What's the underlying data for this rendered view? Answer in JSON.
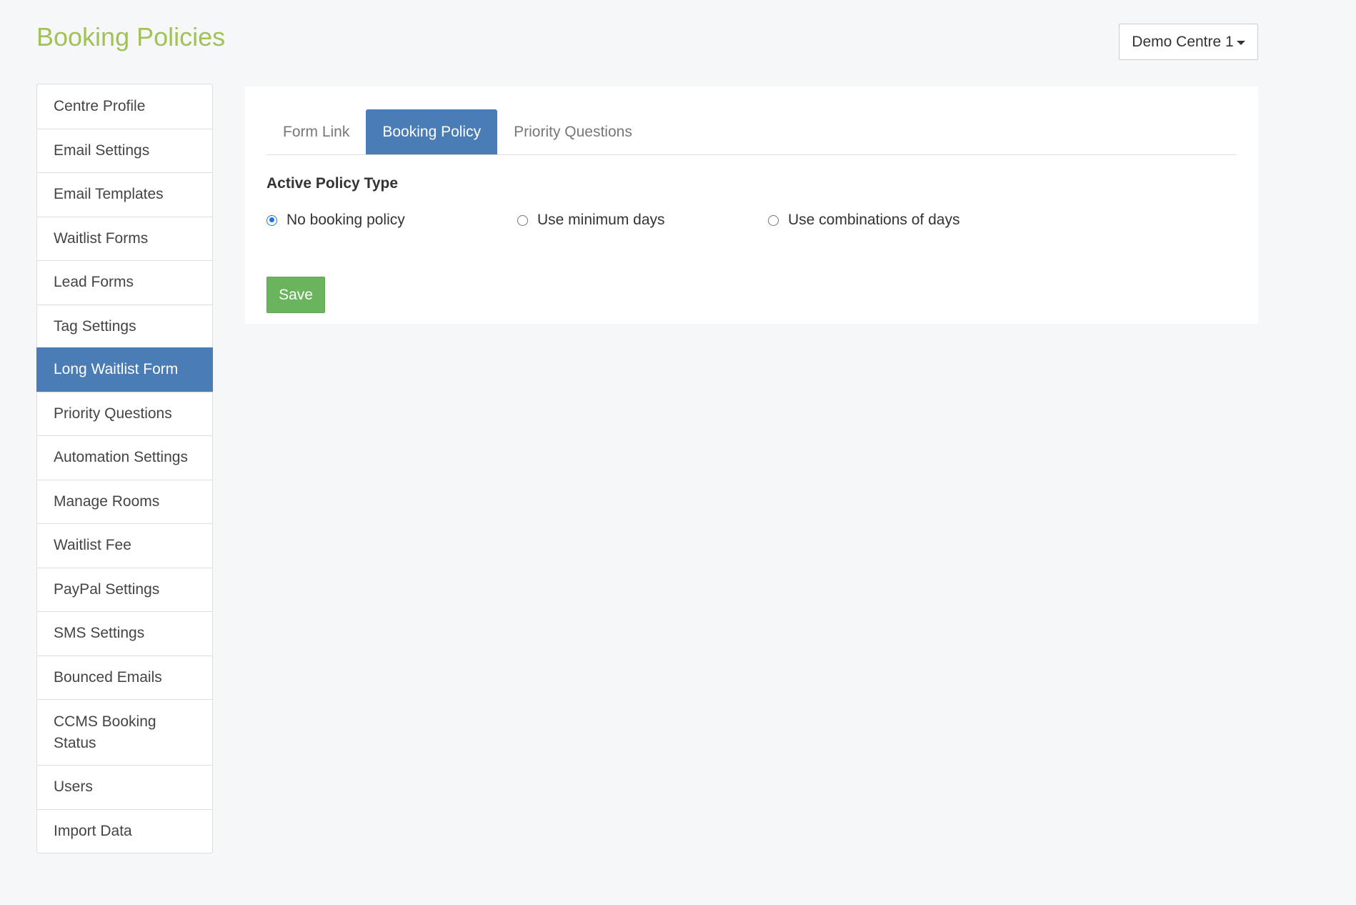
{
  "header": {
    "title": "Booking Policies",
    "centre_selector": "Demo Centre 1"
  },
  "sidebar": {
    "items": [
      {
        "label": "Centre Profile"
      },
      {
        "label": "Email Settings"
      },
      {
        "label": "Email Templates"
      },
      {
        "label": "Waitlist Forms"
      },
      {
        "label": "Lead Forms"
      },
      {
        "label": "Tag Settings"
      },
      {
        "label": "Long Waitlist Form",
        "active": true
      },
      {
        "label": "Priority Questions"
      },
      {
        "label": "Automation Settings"
      },
      {
        "label": "Manage Rooms"
      },
      {
        "label": "Waitlist Fee"
      },
      {
        "label": "PayPal Settings"
      },
      {
        "label": "SMS Settings"
      },
      {
        "label": "Bounced Emails"
      },
      {
        "label": "CCMS Booking Status"
      },
      {
        "label": "Users"
      },
      {
        "label": "Import Data"
      }
    ]
  },
  "tabs": [
    {
      "label": "Form Link"
    },
    {
      "label": "Booking Policy",
      "active": true
    },
    {
      "label": "Priority Questions"
    }
  ],
  "policy": {
    "label": "Active Policy Type",
    "options": [
      {
        "label": "No booking policy",
        "checked": true
      },
      {
        "label": "Use minimum days",
        "checked": false
      },
      {
        "label": "Use combinations of days",
        "checked": false
      }
    ]
  },
  "actions": {
    "save_label": "Save"
  },
  "colors": {
    "title": "#a2c257",
    "accent": "#4a7db5",
    "save": "#6ab45e",
    "background": "#f6f7f9"
  }
}
